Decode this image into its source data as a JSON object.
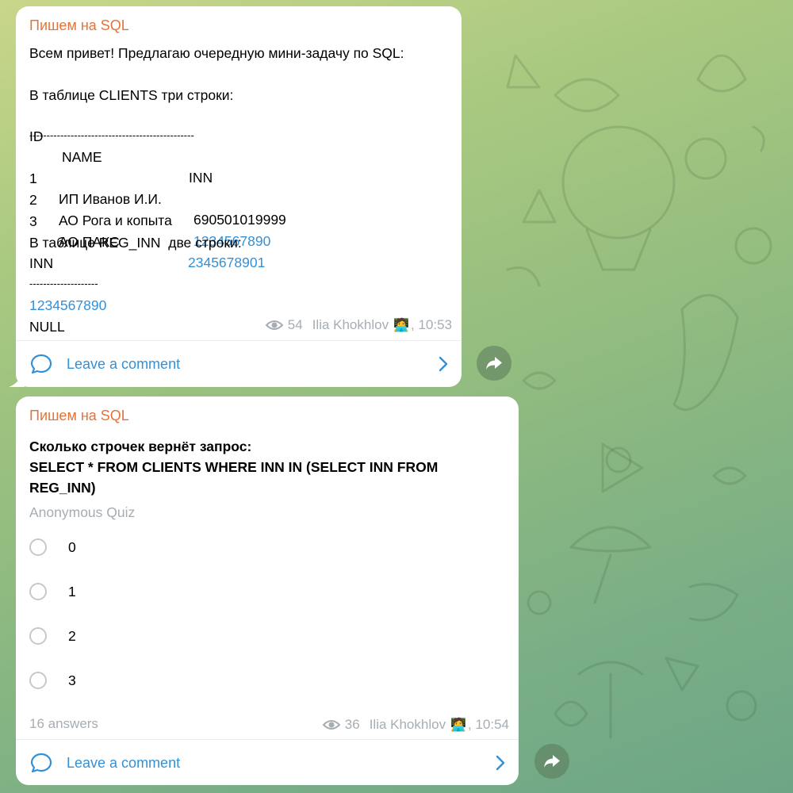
{
  "messages": [
    {
      "channel": "Пишем на SQL",
      "lines": [
        {
          "text": "Всем привет! Предлагаю очередную мини-задачу по SQL:"
        },
        {
          "text": ""
        },
        {
          "text": "В таблице CLIENTS три строки:"
        },
        {
          "cols": [
            "ID",
            "NAME",
            "INN"
          ]
        },
        {
          "text": "------------------------------------------------"
        },
        {
          "cols": [
            "1",
            "ИП Иванов И.И.",
            "690501019999"
          ],
          "link": false
        },
        {
          "cols": [
            "2",
            "АО Рога и копыта",
            "1234567890"
          ],
          "link": true
        },
        {
          "cols": [
            "3",
            "АО ПАКС",
            "2345678901"
          ],
          "link": true
        },
        {
          "text": ""
        },
        {
          "text": "В таблице REG_INN  две строки:"
        },
        {
          "text": "INN"
        },
        {
          "text": "--------------------"
        },
        {
          "text": "1234567890",
          "link": true
        },
        {
          "text": "NULL"
        }
      ],
      "views": "54",
      "author": "Ilia Khokhlov",
      "author_emoji": "🧑‍💻",
      "time": ", 10:53",
      "comment_label": "Leave a comment"
    },
    {
      "channel": "Пишем на SQL",
      "question": [
        "Сколько строчек вернёт запрос:",
        "SELECT * FROM CLIENTS WHERE INN IN (SELECT INN FROM",
        "REG_INN)"
      ],
      "quiz_type": "Anonymous Quiz",
      "options": [
        "0",
        "1",
        "2",
        "3"
      ],
      "answers": "16 answers",
      "views": "36",
      "author": "Ilia Khokhlov",
      "author_emoji": "🧑‍💻",
      "time": ", 10:54",
      "comment_label": "Leave a comment"
    }
  ],
  "icons": [
    "eye-icon",
    "comment-bubble-icon",
    "chevron-right-icon",
    "share-arrow-icon",
    "radio-icon"
  ]
}
